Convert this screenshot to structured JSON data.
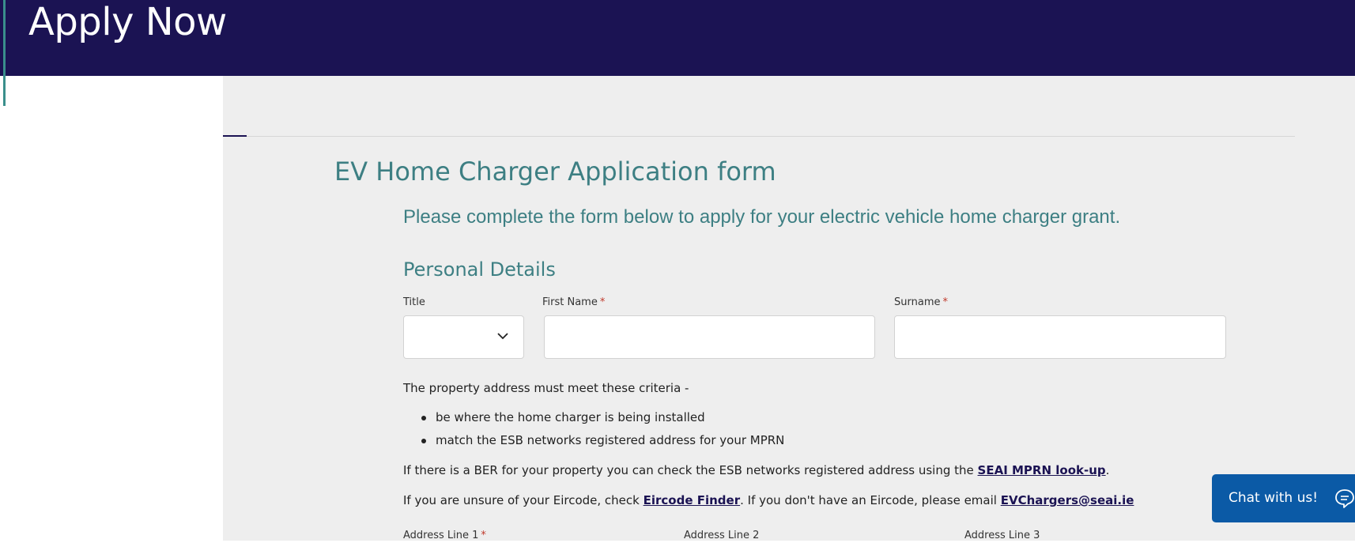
{
  "header": {
    "title": "Apply Now"
  },
  "form": {
    "title": "EV Home Charger Application form",
    "intro": "Please complete the form below to apply for your electric vehicle home charger grant.",
    "section_title": "Personal Details",
    "fields": {
      "title": {
        "label": "Title",
        "value": ""
      },
      "first_name": {
        "label": "First Name",
        "required_mark": "*",
        "value": ""
      },
      "surname": {
        "label": "Surname",
        "required_mark": "*",
        "value": ""
      }
    },
    "criteria_intro": "The property address must meet these criteria -",
    "criteria": [
      "be where the home charger is being installed",
      "match the ESB networks registered address for your MPRN"
    ],
    "ber_text": "If there is a BER for your property you can check the ESB networks registered address using the ",
    "ber_link": "SEAI MPRN look-up",
    "ber_end": ".",
    "eircode_text": "If you are unsure of your Eircode, check ",
    "eircode_link": "Eircode Finder",
    "eircode_mid": ". If you don't have an Eircode, please email ",
    "email_link": "EVChargers@seai.ie",
    "address": {
      "line1": {
        "label": "Address Line 1",
        "required_mark": "*"
      },
      "line2": {
        "label": "Address Line 2"
      },
      "line3": {
        "label": "Address Line 3"
      }
    }
  },
  "chat": {
    "label": "Chat with us!",
    "icon": "chat-bubble-icon"
  }
}
